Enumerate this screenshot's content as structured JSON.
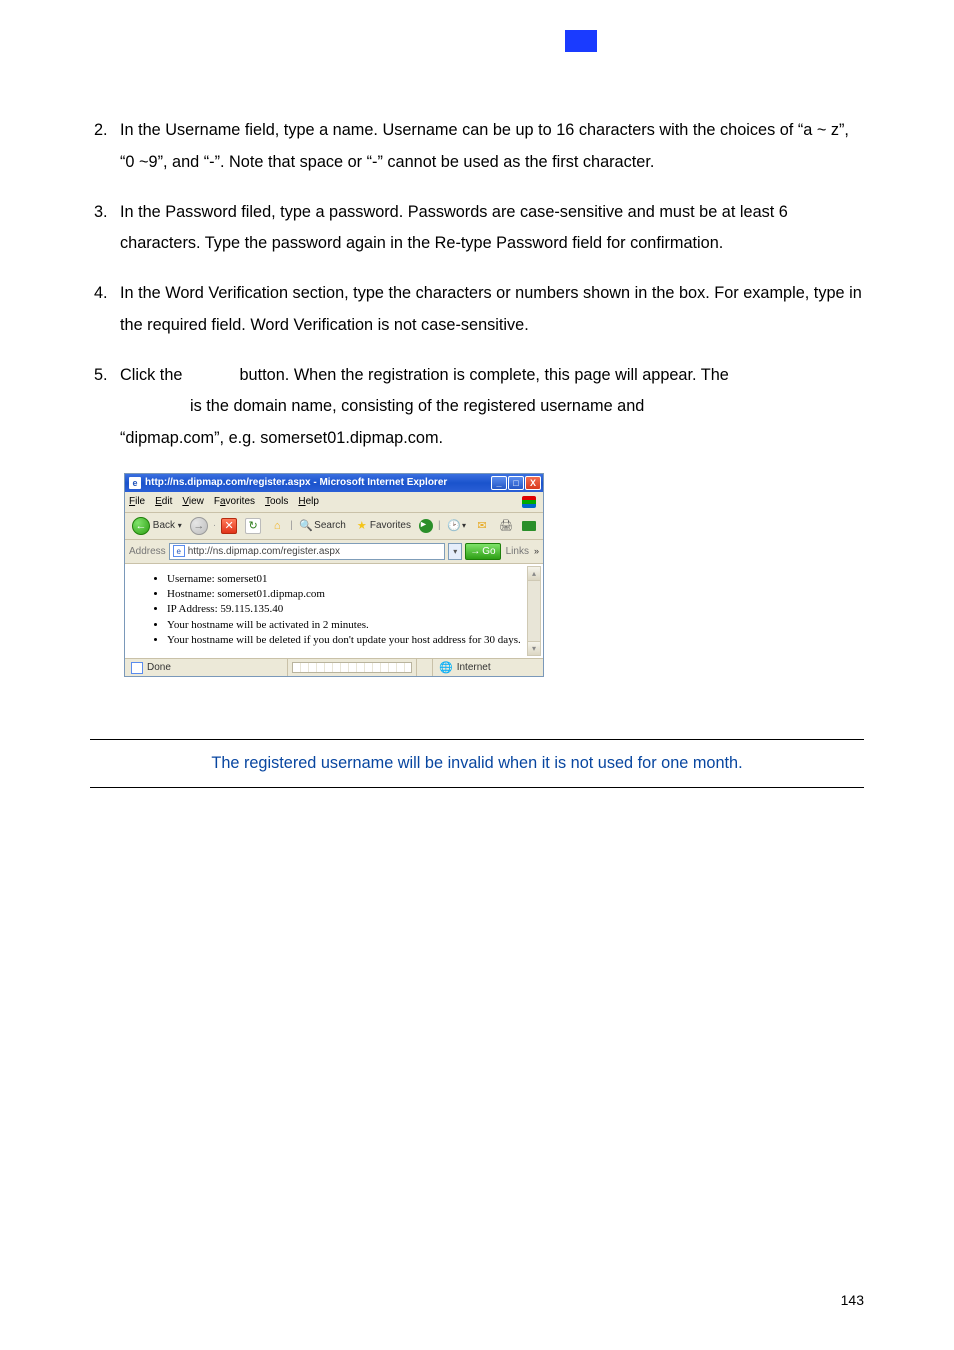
{
  "list": {
    "item2": {
      "num": "2.",
      "text": "In the Username field, type a name. Username can be up to 16 characters with the choices of “a ~ z”, “0 ~9”, and “-”. Note that space or “-” cannot be used as the first character."
    },
    "item3": {
      "num": "3.",
      "text": "In the Password filed, type a password. Passwords are case-sensitive and must be at least 6 characters. Type the password again in the Re-type Password field for confirmation."
    },
    "item4": {
      "num": "4.",
      "text": "In the Word Verification section, type the characters or numbers shown in the box. For example, type            in the required field. Word Verification is not case-sensitive."
    },
    "item5": {
      "num": "5.",
      "line1a": "Click the",
      "line1b": "button. When the registration is complete, this page will appear. The",
      "line2": "is the domain name, consisting of the registered username and",
      "line3": "“dipmap.com”, e.g. somerset01.dipmap.com."
    }
  },
  "ie": {
    "title": "http://ns.dipmap.com/register.aspx - Microsoft Internet Explorer",
    "menu": {
      "file": "File",
      "edit": "Edit",
      "view": "View",
      "favorites": "Favorites",
      "tools": "Tools",
      "help": "Help"
    },
    "toolbar": {
      "back": "Back",
      "search": "Search",
      "favorites": "Favorites"
    },
    "address": {
      "label": "Address",
      "url": "http://ns.dipmap.com/register.aspx",
      "go": "Go",
      "links": "Links"
    },
    "body": {
      "l1": "Username: somerset01",
      "l2": "Hostname: somerset01.dipmap.com",
      "l3": "IP Address: 59.115.135.40",
      "l4": "Your hostname will be activated in 2 minutes.",
      "l5": "Your hostname will be deleted if you don't update your host address for 30 days."
    },
    "status": {
      "done": "Done",
      "zone": "Internet"
    }
  },
  "note": "The registered username will be invalid when it is not used for one month.",
  "pagenum": "143"
}
